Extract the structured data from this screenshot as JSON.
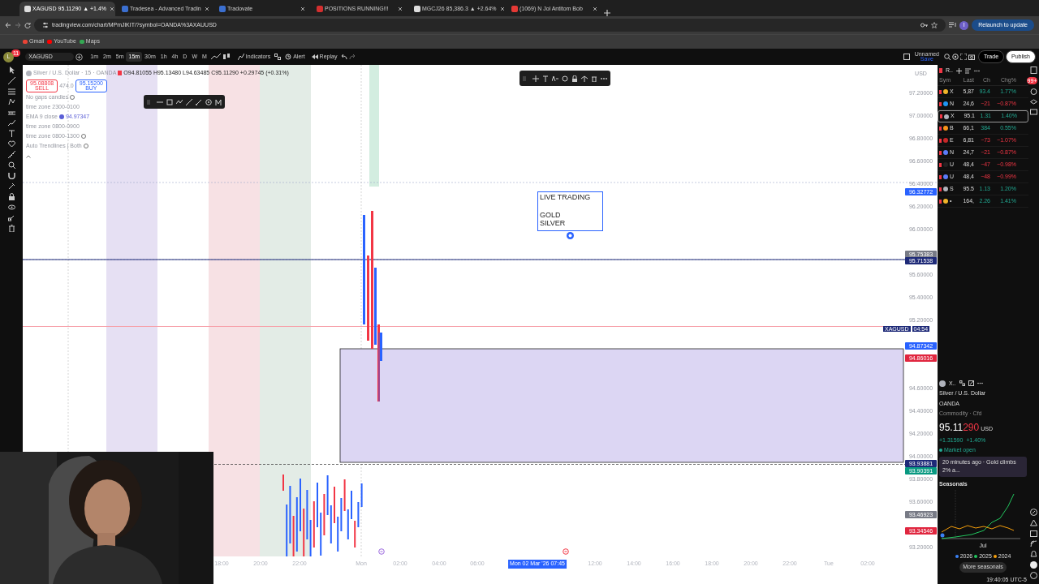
{
  "browser_tabs": [
    {
      "title": "XAGUSD 95.11290 ▲ +1.4%",
      "selected": true
    },
    {
      "title": "Tradesea - Advanced Tradin",
      "selected": false
    },
    {
      "title": "Tradovate",
      "selected": false
    },
    {
      "title": "POSITIONS RUNNING!!!",
      "selected": false
    },
    {
      "title": "MGCJ26 85,386.3 ▲ +2.64%",
      "selected": false
    },
    {
      "title": "(1069) N Jol Antitom Bob",
      "selected": false
    }
  ],
  "address_bar": {
    "url": "tradingview.com/chart/MPmJlKIT/?symbol=OANDA%3AXAUUSD",
    "profile": "I",
    "relaunch": "Relaunch to update"
  },
  "bookmarks": [
    "Gmail",
    "YouTube",
    "Maps"
  ],
  "toolbar": {
    "avatar": "L",
    "notifications": "11",
    "symbol": "XAGUSD",
    "intervals": [
      {
        "label": "1m",
        "selected": false
      },
      {
        "label": "2m",
        "selected": false
      },
      {
        "label": "5m",
        "selected": false
      },
      {
        "label": "15m",
        "selected": true
      },
      {
        "label": "30m",
        "selected": false
      },
      {
        "label": "1h",
        "selected": false
      },
      {
        "label": "4h",
        "selected": false
      },
      {
        "label": "D",
        "selected": false
      },
      {
        "label": "W",
        "selected": false
      },
      {
        "label": "M",
        "selected": false
      }
    ],
    "indicators": "Indicators",
    "alert": "Alert",
    "replay": "Replay",
    "layout": "Unnamed",
    "layout_status": "Save",
    "trade": "Trade",
    "publish": "Publish"
  },
  "legend": {
    "title": "Silver / U.S. Dollar · 15 · OANDA",
    "ohlc": "O94.81055 H95.13480 L94.63485 C95.11290 +0.29745 (+0.31%)",
    "sell_price": "95.08808",
    "sell": "SELL",
    "spread": "474.0",
    "buy_price": "95.15200",
    "buy": "BUY",
    "indicators": [
      {
        "label": "No gaps candles"
      },
      {
        "label": "time zone 2300-0100"
      },
      {
        "label": "EMA 9 close",
        "value": "94.97347"
      },
      {
        "label": "time zone 0800-0900"
      },
      {
        "label": "time zone 0800-1300"
      },
      {
        "label": "Auto Trendlines | Both"
      }
    ]
  },
  "text_note": {
    "lines": [
      "LIVE TRADING",
      "GOLD",
      "SILVER"
    ]
  },
  "price_axis": {
    "currency": "USD",
    "labels": [
      {
        "text": "97.20000",
        "kind": "tick"
      },
      {
        "text": "97.00000",
        "kind": "tick"
      },
      {
        "text": "96.80000",
        "kind": "tick"
      },
      {
        "text": "96.60000",
        "kind": "tick"
      },
      {
        "text": "96.40000",
        "kind": "tick"
      },
      {
        "text": "96.32772",
        "kind": "badge",
        "color": "#2962ff"
      },
      {
        "text": "96.20000",
        "kind": "tick"
      },
      {
        "text": "96.00000",
        "kind": "tick"
      },
      {
        "text": "95.75383",
        "kind": "badge",
        "color": "#787b86"
      },
      {
        "text": "95.71538",
        "kind": "badge",
        "color": "#1e2a78"
      },
      {
        "text": "95.60000",
        "kind": "tick"
      },
      {
        "text": "95.40000",
        "kind": "tick"
      },
      {
        "text": "95.20000",
        "kind": "tick"
      },
      {
        "text": "94.87342",
        "kind": "badge",
        "color": "#2962ff"
      },
      {
        "text": "94.86016",
        "kind": "badge",
        "color": "#e0263f"
      },
      {
        "text": "94.60000",
        "kind": "tick"
      },
      {
        "text": "94.40000",
        "kind": "tick"
      },
      {
        "text": "94.20000",
        "kind": "tick"
      },
      {
        "text": "94.00000",
        "kind": "tick"
      },
      {
        "text": "93.93881",
        "kind": "badge",
        "color": "#1e2a78"
      },
      {
        "text": "93.90391",
        "kind": "badge",
        "color": "#089981"
      },
      {
        "text": "93.80000",
        "kind": "tick"
      },
      {
        "text": "93.60000",
        "kind": "tick"
      },
      {
        "text": "93.46923",
        "kind": "badge",
        "color": "#787b86"
      },
      {
        "text": "93.34546",
        "kind": "badge",
        "color": "#e0263f"
      },
      {
        "text": "93.20000",
        "kind": "tick"
      }
    ],
    "symbol_tag": "XAGUSD",
    "countdown": "04:54"
  },
  "time_axis": {
    "labels": [
      "18:00",
      "20:00",
      "22:00",
      "Mon",
      "02:00",
      "04:00",
      "06:00",
      "12:00",
      "14:00",
      "16:00",
      "18:00",
      "20:00",
      "22:00",
      "Tue",
      "02:00"
    ],
    "crosshair": "Mon 02 Mar '26 07:45"
  },
  "watchlist": {
    "title": "R..",
    "badge": "99+",
    "columns": [
      "Sym",
      "Last",
      "Ch",
      "Chg%"
    ],
    "rows": [
      {
        "sym": "X",
        "last": "5,87",
        "ch": "93.4",
        "chg": "1.77%",
        "up": true,
        "selected": false,
        "color": "#f0b429"
      },
      {
        "sym": "N",
        "last": "24,6",
        "ch": "−21",
        "chg": "−0.87%",
        "up": false,
        "selected": false,
        "color": "#2196f3"
      },
      {
        "sym": "X",
        "last": "95.1",
        "ch": "1.31",
        "chg": "1.40%",
        "up": true,
        "selected": true,
        "color": "#b0b3bc"
      },
      {
        "sym": "B",
        "last": "66,1",
        "ch": "384",
        "chg": "0.55%",
        "up": true,
        "selected": false,
        "color": "#f7931a"
      },
      {
        "sym": "E",
        "last": "6,81",
        "ch": "−73",
        "chg": "−1.07%",
        "up": false,
        "selected": false,
        "color": "#c62828"
      },
      {
        "sym": "N",
        "last": "24,7",
        "ch": "−21",
        "chg": "−0.87%",
        "up": false,
        "selected": false,
        "color": "#5c7cfa"
      },
      {
        "sym": "U",
        "last": "48,4",
        "ch": "−47",
        "chg": "−0.98%",
        "up": false,
        "selected": false,
        "color": "#222222"
      },
      {
        "sym": "U",
        "last": "48,4",
        "ch": "−48",
        "chg": "−0.99%",
        "up": false,
        "selected": false,
        "color": "#5c7cfa"
      },
      {
        "sym": "S",
        "last": "95.5",
        "ch": "1.13",
        "chg": "1.20%",
        "up": true,
        "selected": false,
        "color": "#b0b3bc"
      },
      {
        "sym": "•",
        "last": "164,",
        "ch": "2.26",
        "chg": "1.41%",
        "up": true,
        "selected": false,
        "color": "#f0b429"
      }
    ]
  },
  "details": {
    "symbol": "X..",
    "name": "Silver / U.S. Dollar",
    "exchange": "OANDA",
    "category": "Commodity · Cfd",
    "price": "95.11",
    "price_tail": "290",
    "currency": "USD",
    "change": "+1.31590",
    "change_pct": "+1.40%",
    "status": "Market open",
    "news": "20 minutes ago · Gold climbs 2% a...",
    "seasonals": "Seasonals",
    "month": "Jul",
    "series": [
      {
        "name": "2026",
        "color": "#3b82f6"
      },
      {
        "name": "2025",
        "color": "#22c55e"
      },
      {
        "name": "2024",
        "color": "#f59e0b"
      }
    ],
    "more": "More seasonals"
  },
  "clock": "19:40:05 UTC-5"
}
